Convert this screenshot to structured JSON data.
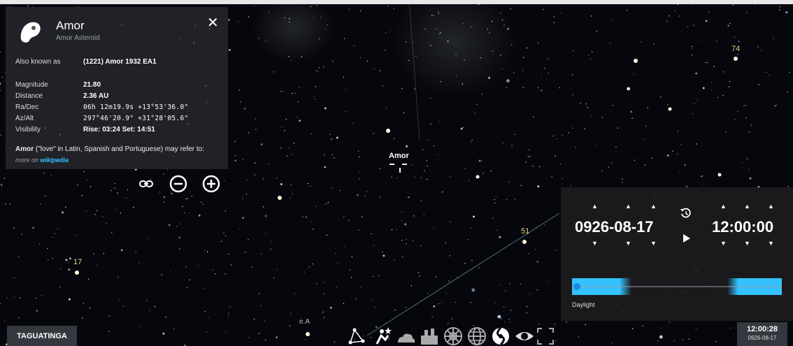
{
  "info_panel": {
    "title": "Amor",
    "subtitle": "Amor Asteroid",
    "rows": [
      {
        "key": "Also known as",
        "value": "(1221) Amor   1932 EA1"
      },
      {
        "key": "Magnitude",
        "value": "21.80"
      },
      {
        "key": "Distance",
        "value": "2.36 AU"
      },
      {
        "key": "Ra/Dec",
        "value": "06h 12m19.9s  +13°53'36.0\""
      },
      {
        "key": "Az/Alt",
        "value": "297°46'20.9\"  +31°28'05.6\""
      },
      {
        "key": "Visibility",
        "value": "Rise: 03:24   Set: 14:51"
      }
    ],
    "description_bold": "Amor",
    "description_rest": " (\"love\" in Latin, Spanish and Portuguese) may refer to:",
    "more_prefix": "more on ",
    "more_link": "wikipedia"
  },
  "target_label": "Amor",
  "star_labels": [
    {
      "text": "74"
    },
    {
      "text": "51"
    },
    {
      "text": "17"
    },
    {
      "text": "e.A"
    }
  ],
  "time_panel": {
    "date": "0926-08-17",
    "time": "12:00:00",
    "day_label": "Daylight"
  },
  "location_button": "TAGUATINGA",
  "clock": {
    "time": "12:00:28",
    "date": "0926-08-17"
  },
  "colors": {
    "accent": "#33c2ff",
    "panel": "#28282d",
    "star_label": "#f0d28a"
  }
}
